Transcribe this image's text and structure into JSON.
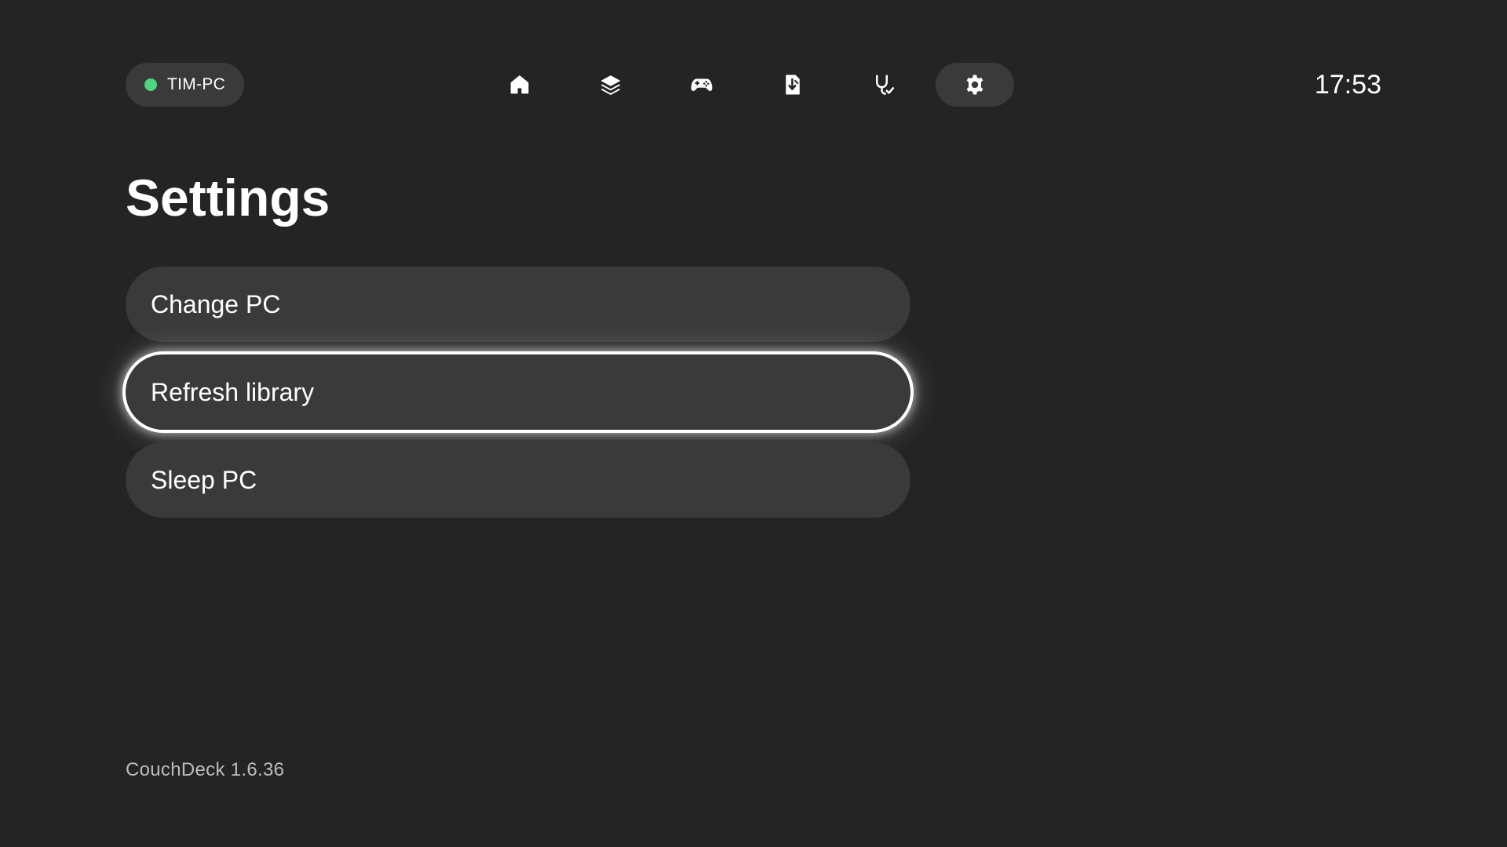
{
  "header": {
    "pc_name": "TIM-PC",
    "status_color": "#4cd680",
    "clock": "17:53",
    "nav": [
      {
        "icon": "home-icon",
        "active": false
      },
      {
        "icon": "layers-icon",
        "active": false
      },
      {
        "icon": "gamepad-icon",
        "active": false
      },
      {
        "icon": "device-icon",
        "active": false
      },
      {
        "icon": "stethoscope-icon",
        "active": false
      },
      {
        "icon": "gear-icon",
        "active": true
      }
    ]
  },
  "main": {
    "title": "Settings",
    "menu": [
      {
        "label": "Change PC",
        "focused": false
      },
      {
        "label": "Refresh library",
        "focused": true
      },
      {
        "label": "Sleep PC",
        "focused": false
      }
    ]
  },
  "footer": {
    "version": "CouchDeck 1.6.36"
  },
  "colors": {
    "background": "#242424",
    "surface": "#3a3a3a",
    "text": "#ffffff",
    "muted_text": "#bdbdbd",
    "focus_ring": "#ffffff"
  }
}
